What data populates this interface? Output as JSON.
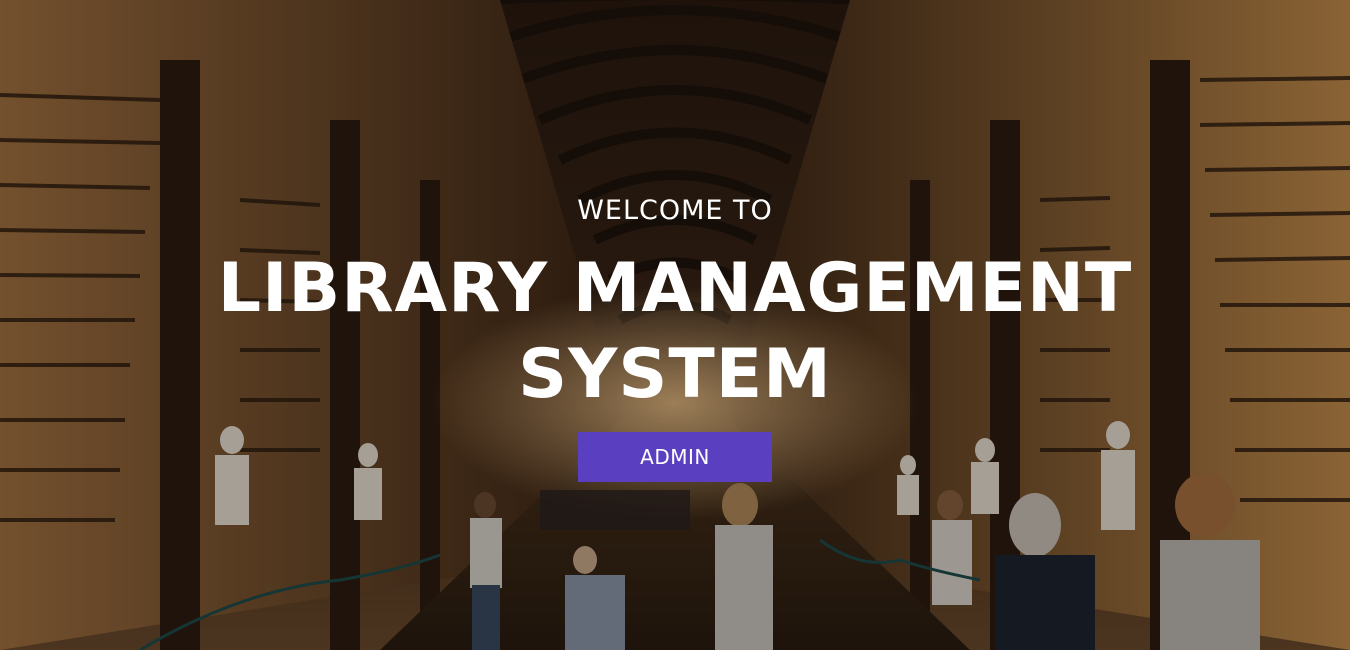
{
  "hero": {
    "welcome_text": "WELCOME TO",
    "title_line1": "LIBRARY MANAGEMENT",
    "title_line2": "SYSTEM",
    "admin_button_label": "ADMIN",
    "background_description": "photo-library-hall"
  },
  "colors": {
    "button_background": "#5a3fc0",
    "text": "#ffffff",
    "overlay": "rgba(0,0,0,0.28)"
  }
}
